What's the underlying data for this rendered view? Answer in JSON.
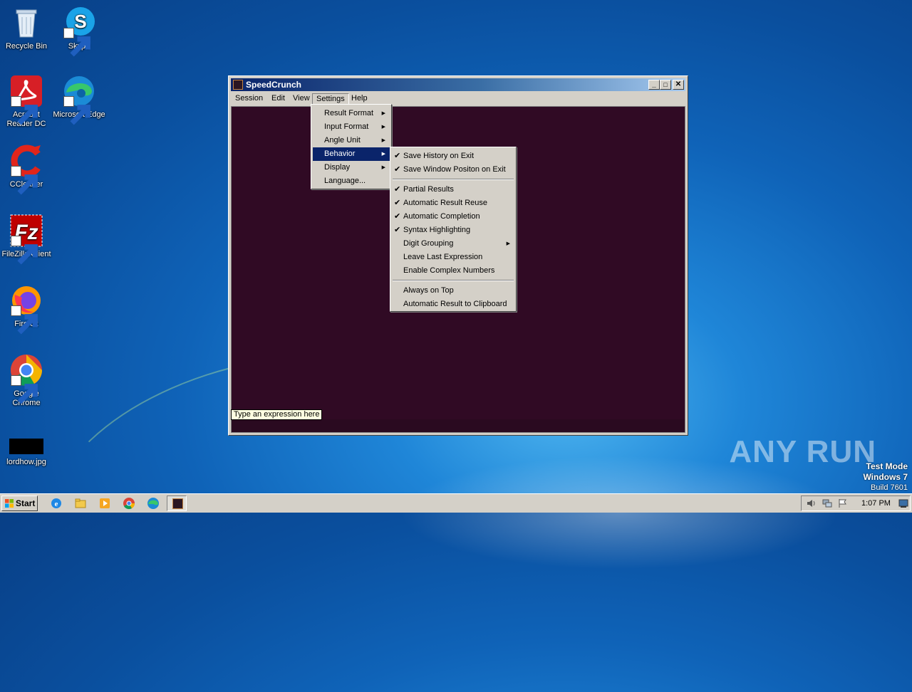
{
  "desktop": {
    "icons": [
      {
        "label": "Recycle Bin",
        "icon": "recycle-bin-icon"
      },
      {
        "label": "Skype",
        "icon": "skype-icon"
      },
      {
        "label": "Acrobat Reader DC",
        "icon": "acrobat-icon"
      },
      {
        "label": "Microsoft Edge",
        "icon": "edge-icon"
      },
      {
        "label": "CCleaner",
        "icon": "ccleaner-icon"
      },
      {
        "label": "FileZilla Client",
        "icon": "filezilla-icon"
      },
      {
        "label": "Firefox",
        "icon": "firefox-icon"
      },
      {
        "label": "Google Chrome",
        "icon": "chrome-icon"
      },
      {
        "label": "lordhow.jpg",
        "icon": "image-file-icon"
      }
    ]
  },
  "window": {
    "title": "SpeedCrunch",
    "menu": [
      "Session",
      "Edit",
      "View",
      "Settings",
      "Help"
    ],
    "input_placeholder": "Type an expression here",
    "controls": {
      "minimize": "_",
      "maximize": "□",
      "close": "✕"
    }
  },
  "settings_menu": {
    "items": [
      "Result Format",
      "Input Format",
      "Angle Unit",
      "Behavior",
      "Display",
      "Language..."
    ],
    "highlighted": "Behavior"
  },
  "behavior_menu": {
    "items": [
      {
        "label": "Save History on Exit",
        "checked": true
      },
      {
        "label": "Save Window Positon on Exit",
        "checked": true
      },
      {
        "label": "Partial Results",
        "checked": true
      },
      {
        "label": "Automatic Result Reuse",
        "checked": true
      },
      {
        "label": "Automatic Completion",
        "checked": true
      },
      {
        "label": "Syntax Highlighting",
        "checked": true
      },
      {
        "label": "Digit Grouping",
        "checked": false,
        "submenu": true
      },
      {
        "label": "Leave Last Expression",
        "checked": false
      },
      {
        "label": "Enable Complex Numbers",
        "checked": false
      },
      {
        "label": "Always on Top",
        "checked": false
      },
      {
        "label": "Automatic Result to Clipboard",
        "checked": false
      }
    ],
    "check_glyph": "✔",
    "arrow_glyph": "▶"
  },
  "taskbar": {
    "start_label": "Start",
    "clock": "1:07 PM",
    "pinned": [
      "ie-icon",
      "explorer-icon",
      "media-player-icon",
      "chrome-icon",
      "edge-icon",
      "speedcrunch-icon"
    ]
  },
  "watermark": {
    "brand": "ANY RUN",
    "line1": "Test Mode",
    "line2": "Windows 7",
    "line3": "Build 7601"
  },
  "colors": {
    "console_bg": "#300a24",
    "title_active": "#0a246a",
    "menu_bg": "#d4d0c8"
  }
}
